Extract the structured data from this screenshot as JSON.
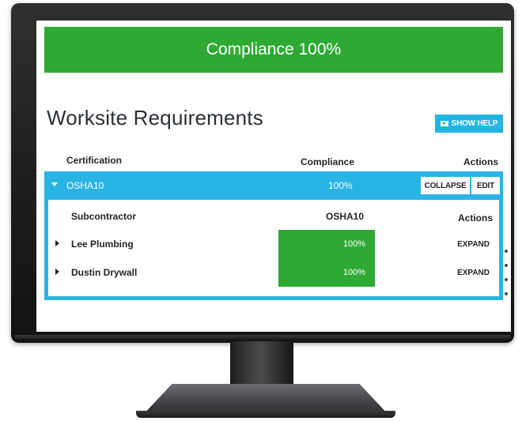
{
  "banner": {
    "text": "Compliance 100%"
  },
  "page": {
    "title": "Worksite Requirements",
    "help_button_label": "SHOW HELP"
  },
  "table": {
    "columns": {
      "certification": "Certification",
      "compliance": "Compliance",
      "actions": "Actions"
    },
    "rows": [
      {
        "certification": "OSHA10",
        "compliance": "100%",
        "collapse_label": "COLLAPSE",
        "edit_label": "EDIT",
        "sub_columns": {
          "subcontractor": "Subcontractor",
          "osha": "OSHA10",
          "actions": "Actions"
        },
        "sub_rows": [
          {
            "subcontractor": "Lee Plumbing",
            "value": "100%",
            "action": "EXPAND"
          },
          {
            "subcontractor": "Dustin Drywall",
            "value": "100%",
            "action": "EXPAND"
          }
        ]
      }
    ]
  },
  "colors": {
    "success": "#2eaa34",
    "accent": "#2ab4e3",
    "text": "#2b3035"
  }
}
